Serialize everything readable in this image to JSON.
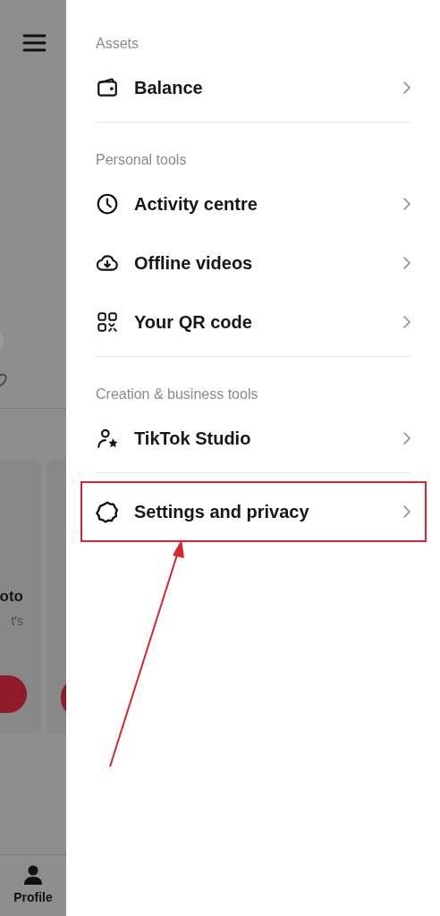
{
  "background": {
    "card_title": "oto",
    "card_subtitle": "t's",
    "nav": [
      {
        "label": "Profile",
        "selected": true
      }
    ]
  },
  "drawer": {
    "sections": [
      {
        "title": "Assets",
        "items": [
          {
            "kind": "wallet",
            "label": "Balance",
            "highlighted": false
          }
        ]
      },
      {
        "title": "Personal tools",
        "items": [
          {
            "kind": "clock",
            "label": "Activity centre",
            "highlighted": false
          },
          {
            "kind": "cloud",
            "label": "Offline videos",
            "highlighted": false
          },
          {
            "kind": "qr",
            "label": "Your QR code",
            "highlighted": false
          }
        ]
      },
      {
        "title": "Creation & business tools",
        "items": [
          {
            "kind": "studio",
            "label": "TikTok Studio",
            "highlighted": false
          }
        ]
      },
      {
        "items": [
          {
            "kind": "gear",
            "label": "Settings and privacy",
            "highlighted": true
          }
        ]
      }
    ]
  }
}
